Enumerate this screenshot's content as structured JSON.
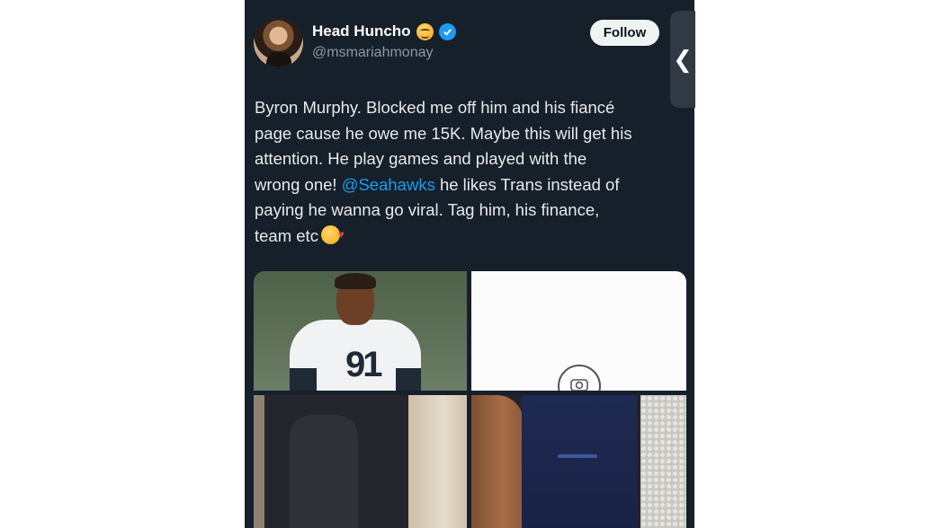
{
  "tweet": {
    "display_name": "Head Huncho",
    "handle": "@msmariahmonay",
    "follow_label": "Follow",
    "side_tab_glyph": "❮",
    "text_lines": [
      "Byron Murphy. Blocked me off him and his fiancé",
      "page cause he owe me 15K. Maybe this will get his",
      "attention. He play games and played with the",
      {
        "before": "wrong one! ",
        "mention": "@Seahawks",
        "after": " he likes Trans instead of"
      },
      "paying he wanna go viral. Tag him, his finance,",
      "team etc"
    ],
    "jersey_number": "91"
  },
  "colors": {
    "card_bg": "#16202b",
    "mention": "#1d9bf0",
    "verified": "#1d9bf0",
    "text": "#e7e9ea",
    "handle": "#8b98a5"
  },
  "icons": {
    "name_emoji": "smiling-face-emoji",
    "verified": "verified-badge-icon",
    "text_emoji": "face-blowing-kiss-emoji",
    "side_tab": "chevron-left-icon",
    "media_camera": "camera-icon"
  }
}
